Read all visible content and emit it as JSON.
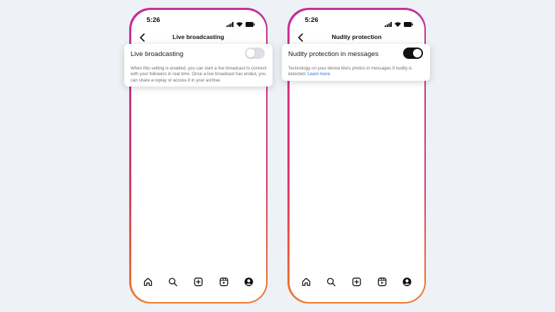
{
  "phones": [
    {
      "status_time": "5:26",
      "title": "Live broadcasting",
      "setting_label": "Live broadcasting",
      "setting_description": "When this setting is enabled, you can start a live broadcast to connect with your followers in real time. Once a live broadcast has ended, you can share a replay or access it in your archive.",
      "toggle_state": "off"
    },
    {
      "status_time": "5:26",
      "title": "Nudity protection",
      "setting_label": "Nudity protection in messages",
      "setting_description": "Technology on your device blurs photos in messages if nudity is detected.",
      "link_text": "Learn more.",
      "toggle_state": "on"
    }
  ],
  "tab_icons": [
    "home-icon",
    "search-icon",
    "create-icon",
    "reels-icon",
    "profile-icon"
  ],
  "colors": {
    "background": "#eef1f5",
    "frame_gradient_top": "#c2309a",
    "frame_gradient_bottom": "#f07a2a",
    "toggle_on": "#121212",
    "toggle_off": "#dcdfe3",
    "link": "#2a6fdb"
  }
}
